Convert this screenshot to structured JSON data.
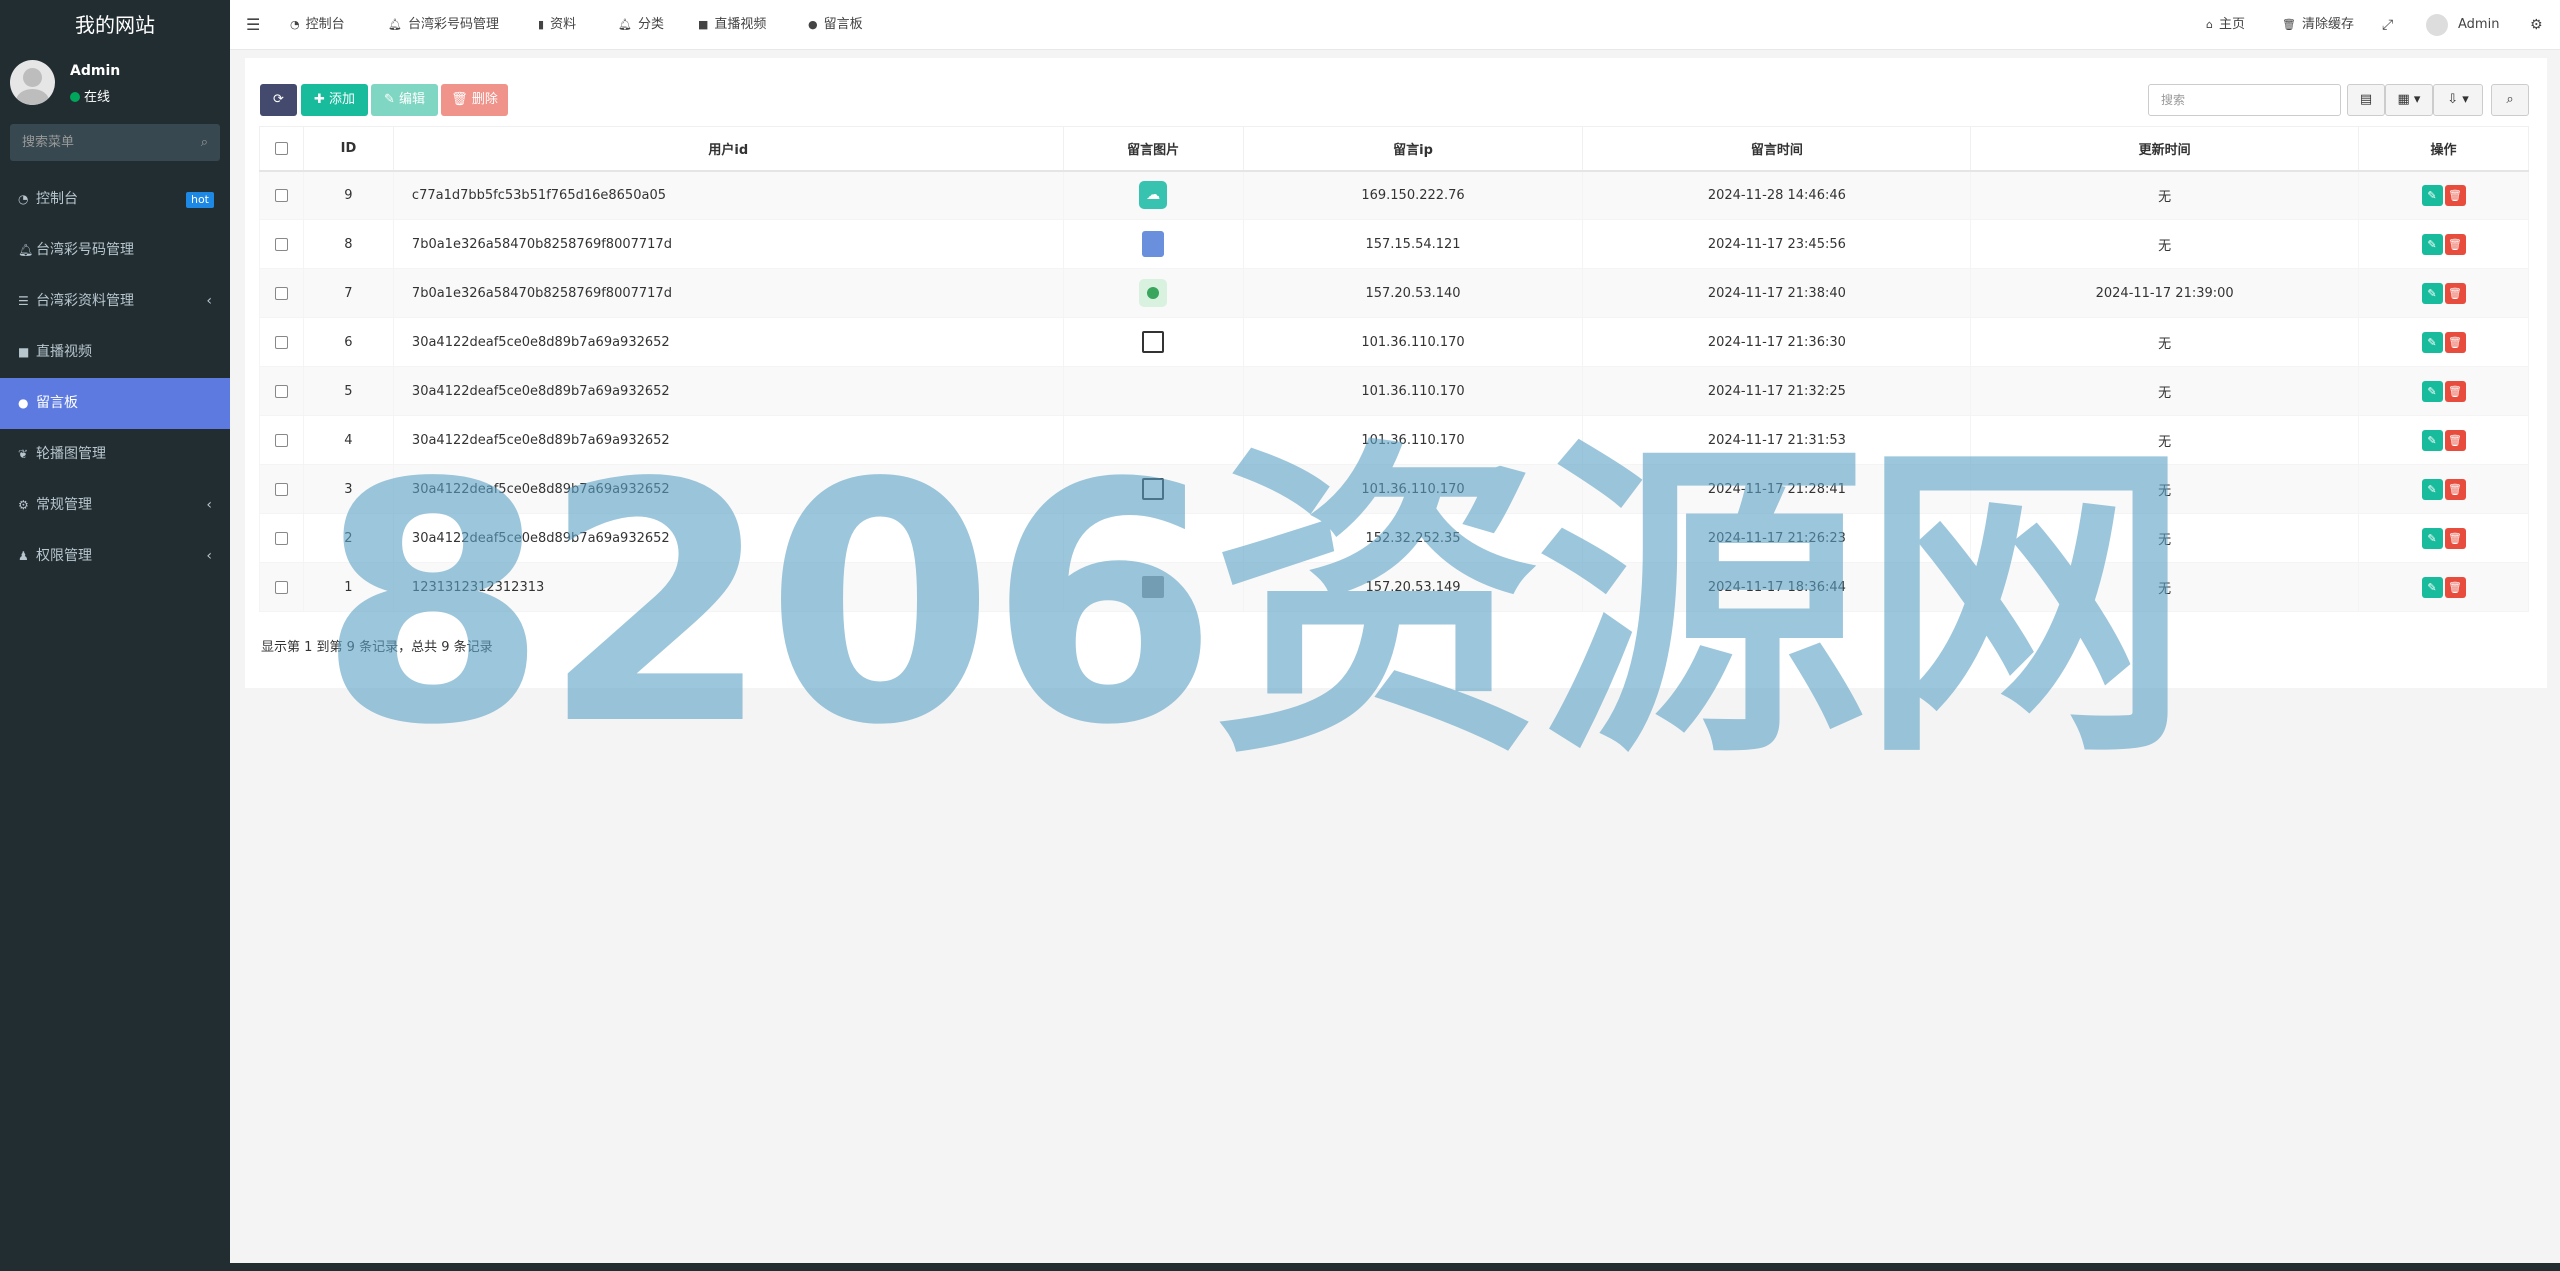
{
  "sidebar": {
    "logo": "我的网站",
    "user": {
      "name": "Admin",
      "status": "在线"
    },
    "search_placeholder": "搜索菜单",
    "items": [
      {
        "label": "控制台",
        "icon": "dashboard-icon",
        "badge": "hot"
      },
      {
        "label": "台湾彩号码管理",
        "icon": "bell-icon"
      },
      {
        "label": "台湾彩资料管理",
        "icon": "list-icon",
        "has_children": true
      },
      {
        "label": "直播视频",
        "icon": "video-icon"
      },
      {
        "label": "留言板",
        "icon": "comment-icon",
        "active": true
      },
      {
        "label": "轮播图管理",
        "icon": "leaf-icon"
      },
      {
        "label": "常规管理",
        "icon": "cogs-icon",
        "has_children": true
      },
      {
        "label": "权限管理",
        "icon": "group-icon",
        "has_children": true
      }
    ]
  },
  "topbar": {
    "tabs": [
      {
        "label": "控制台",
        "icon": "dashboard-icon"
      },
      {
        "label": "台湾彩号码管理",
        "icon": "bell-icon"
      },
      {
        "label": "资料",
        "icon": "bookmark-icon"
      },
      {
        "label": "分类",
        "icon": "bell-icon"
      },
      {
        "label": "直播视频",
        "icon": "video-icon"
      },
      {
        "label": "留言板",
        "icon": "comment-icon"
      }
    ],
    "home": "主页",
    "clear_cache": "清除缓存",
    "user": "Admin"
  },
  "toolbar": {
    "add": "添加",
    "edit": "编辑",
    "delete": "删除",
    "search_placeholder": "搜索"
  },
  "table": {
    "headers": [
      "ID",
      "用户id",
      "留言图片",
      "留言ip",
      "留言时间",
      "更新时间",
      "操作"
    ],
    "rows": [
      {
        "id": "9",
        "uid": "c77a1d7bb5fc53b51f765d16e8650a05",
        "pic": "teal-cloud",
        "ip": "169.150.222.76",
        "time": "2024-11-28 14:46:46",
        "updated": "无"
      },
      {
        "id": "8",
        "uid": "7b0a1e326a58470b8258769f8007717d",
        "pic": "blue-bookmark",
        "ip": "157.15.54.121",
        "time": "2024-11-17 23:45:56",
        "updated": "无"
      },
      {
        "id": "7",
        "uid": "7b0a1e326a58470b8258769f8007717d",
        "pic": "green-circle",
        "ip": "157.20.53.140",
        "time": "2024-11-17 21:38:40",
        "updated": "2024-11-17 21:39:00"
      },
      {
        "id": "6",
        "uid": "30a4122deaf5ce0e8d89b7a69a932652",
        "pic": "outline-box",
        "ip": "101.36.110.170",
        "time": "2024-11-17 21:36:30",
        "updated": "无"
      },
      {
        "id": "5",
        "uid": "30a4122deaf5ce0e8d89b7a69a932652",
        "pic": "",
        "ip": "101.36.110.170",
        "time": "2024-11-17 21:32:25",
        "updated": "无"
      },
      {
        "id": "4",
        "uid": "30a4122deaf5ce0e8d89b7a69a932652",
        "pic": "",
        "ip": "101.36.110.170",
        "time": "2024-11-17 21:31:53",
        "updated": "无"
      },
      {
        "id": "3",
        "uid": "30a4122deaf5ce0e8d89b7a69a932652",
        "pic": "outline-box",
        "ip": "101.36.110.170",
        "time": "2024-11-17 21:28:41",
        "updated": "无"
      },
      {
        "id": "2",
        "uid": "30a4122deaf5ce0e8d89b7a69a932652",
        "pic": "",
        "ip": "152.32.252.35",
        "time": "2024-11-17 21:26:23",
        "updated": "无"
      },
      {
        "id": "1",
        "uid": "1231312312312313",
        "pic": "gray-box",
        "ip": "157.20.53.149",
        "time": "2024-11-17 18:36:44",
        "updated": "无"
      }
    ]
  },
  "summary": "显示第 1 到第 9 条记录，总共 9 条记录",
  "watermark": "8206资源网",
  "colors": {
    "sidebar_bg": "#222d32",
    "active_menu": "#5c7ae0",
    "add": "#18bc9c",
    "edit": "#7fd6c3",
    "delete": "#f0938a",
    "refresh": "#444a6e"
  }
}
